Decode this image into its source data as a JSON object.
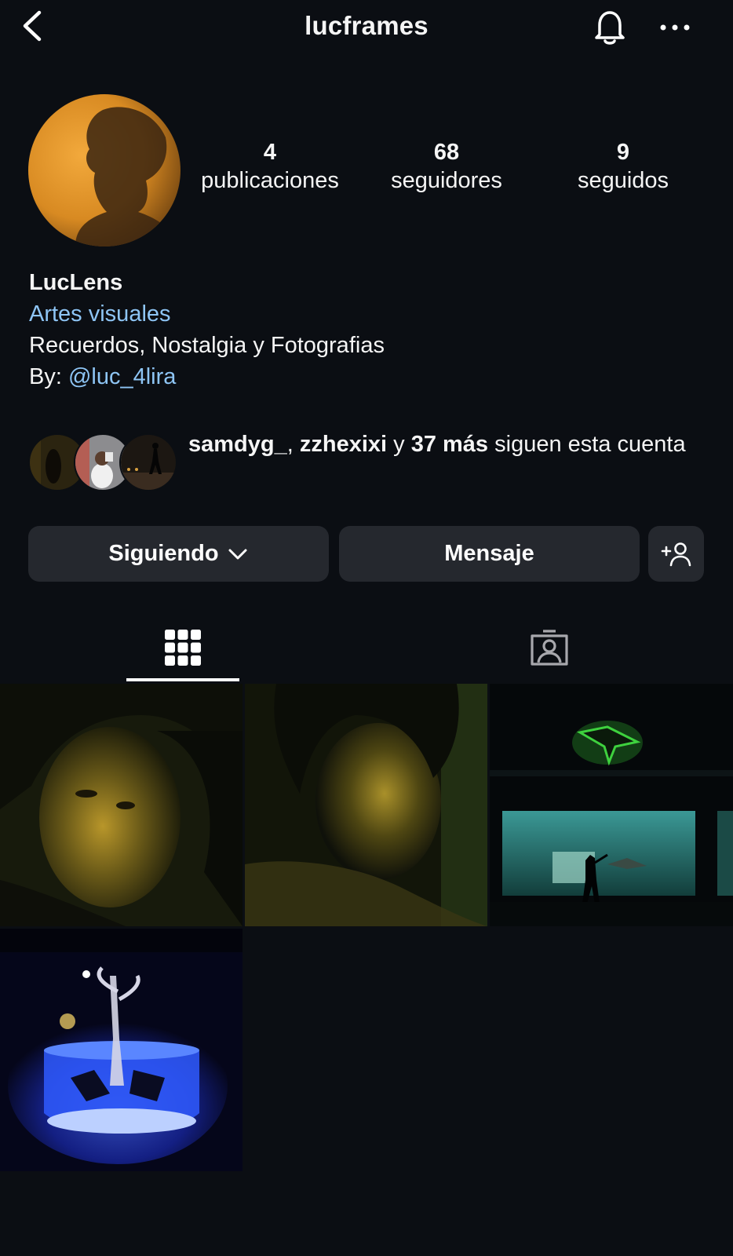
{
  "header": {
    "title": "lucframes",
    "back_icon": "chevron-left-icon",
    "bell_icon": "bell-icon",
    "more_icon": "more-horizontal-icon"
  },
  "stats": {
    "posts_count": "4",
    "posts_label": "publicaciones",
    "followers_count": "68",
    "followers_label": "seguidores",
    "following_count": "9",
    "following_label": "seguidos"
  },
  "bio": {
    "name": "LucLens",
    "category": "Artes visuales",
    "description": "Recuerdos, Nostalgia y Fotografias",
    "by_prefix": "By: ",
    "by_handle": "@luc_4lira"
  },
  "mutual": {
    "user1": "samdyg_",
    "sep": ", ",
    "user2": "zzhexixi",
    "connector": " y ",
    "more": "37 más",
    "suffix": " siguen esta cuenta"
  },
  "actions": {
    "following_label": "Siguiendo",
    "message_label": "Mensaje",
    "add_user_icon": "add-person-icon"
  },
  "tabs": {
    "grid_icon": "grid-icon",
    "tagged_icon": "tagged-person-icon"
  },
  "colors": {
    "background": "#0b0e13",
    "button": "#25282e",
    "link": "#8ec5f5"
  }
}
